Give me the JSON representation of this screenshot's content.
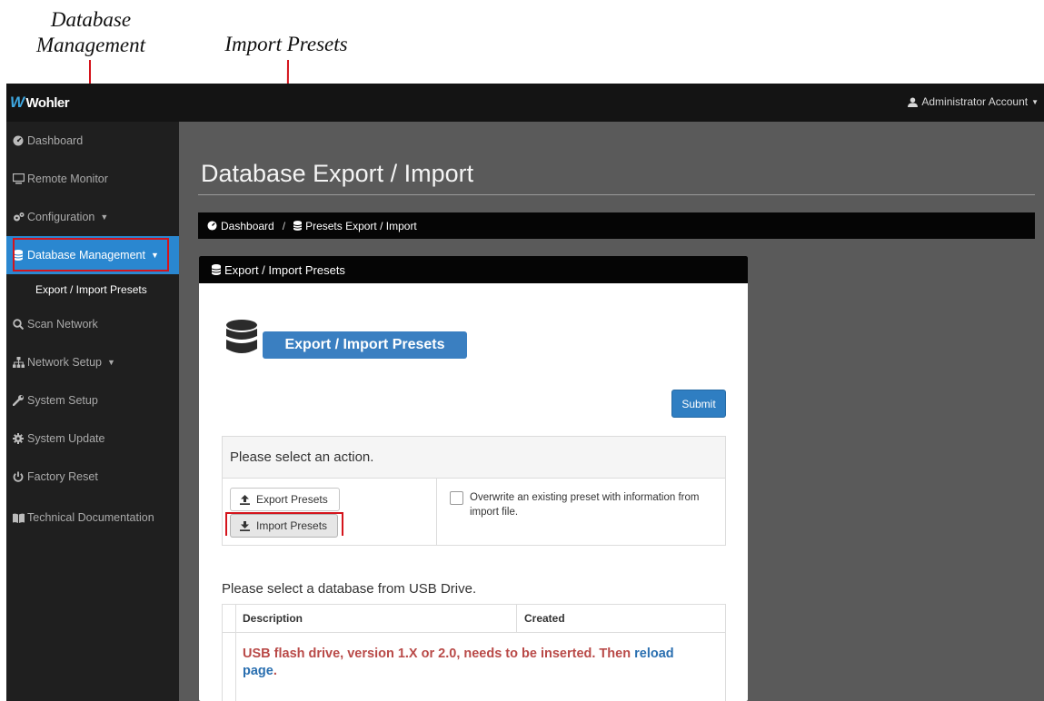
{
  "callouts": {
    "database_management": "Database Management",
    "import_presets": "Import Presets"
  },
  "topbar": {
    "logo_text": "Wohler",
    "account_label": "Administrator Account"
  },
  "sidebar": {
    "items": [
      {
        "label": "Dashboard",
        "icon": "dashboard-icon"
      },
      {
        "label": "Remote Monitor",
        "icon": "monitor-icon"
      },
      {
        "label": "Configuration",
        "icon": "cogs-icon"
      },
      {
        "label": "Database Management",
        "icon": "database-icon",
        "active": true
      },
      {
        "label": "Scan Network",
        "icon": "search-icon"
      },
      {
        "label": "Network Setup",
        "icon": "sitemap-icon"
      },
      {
        "label": "System Setup",
        "icon": "wrench-icon"
      },
      {
        "label": "System Update",
        "icon": "gear-icon"
      },
      {
        "label": "Factory Reset",
        "icon": "power-icon"
      },
      {
        "label": "Technical Documentation",
        "icon": "book-icon"
      }
    ],
    "sub_item": "Export / Import Presets"
  },
  "main": {
    "page_title": "Database Export / Import",
    "breadcrumb": {
      "home": "Dashboard",
      "separator": "/",
      "current": "Presets Export / Import"
    },
    "panel": {
      "header": "Export / Import Presets",
      "badge": "Export / Import Presets",
      "submit_label": "Submit",
      "action_prompt": "Please select an action.",
      "export_label": "Export Presets",
      "import_label": "Import Presets",
      "overwrite_label": "Overwrite an existing preset with information from import file.",
      "overwrite_checked": false,
      "usb_prompt": "Please select a database from USB Drive.",
      "table": {
        "columns": [
          "Description",
          "Created"
        ],
        "warning_text": "USB flash drive, version 1.X or 2.0, needs to be inserted. Then",
        "reload_link": "reload page",
        "warning_end": "."
      }
    }
  },
  "colors": {
    "accent": "#2a87d0",
    "callout": "#d4141c",
    "warning": "#b94a48"
  }
}
